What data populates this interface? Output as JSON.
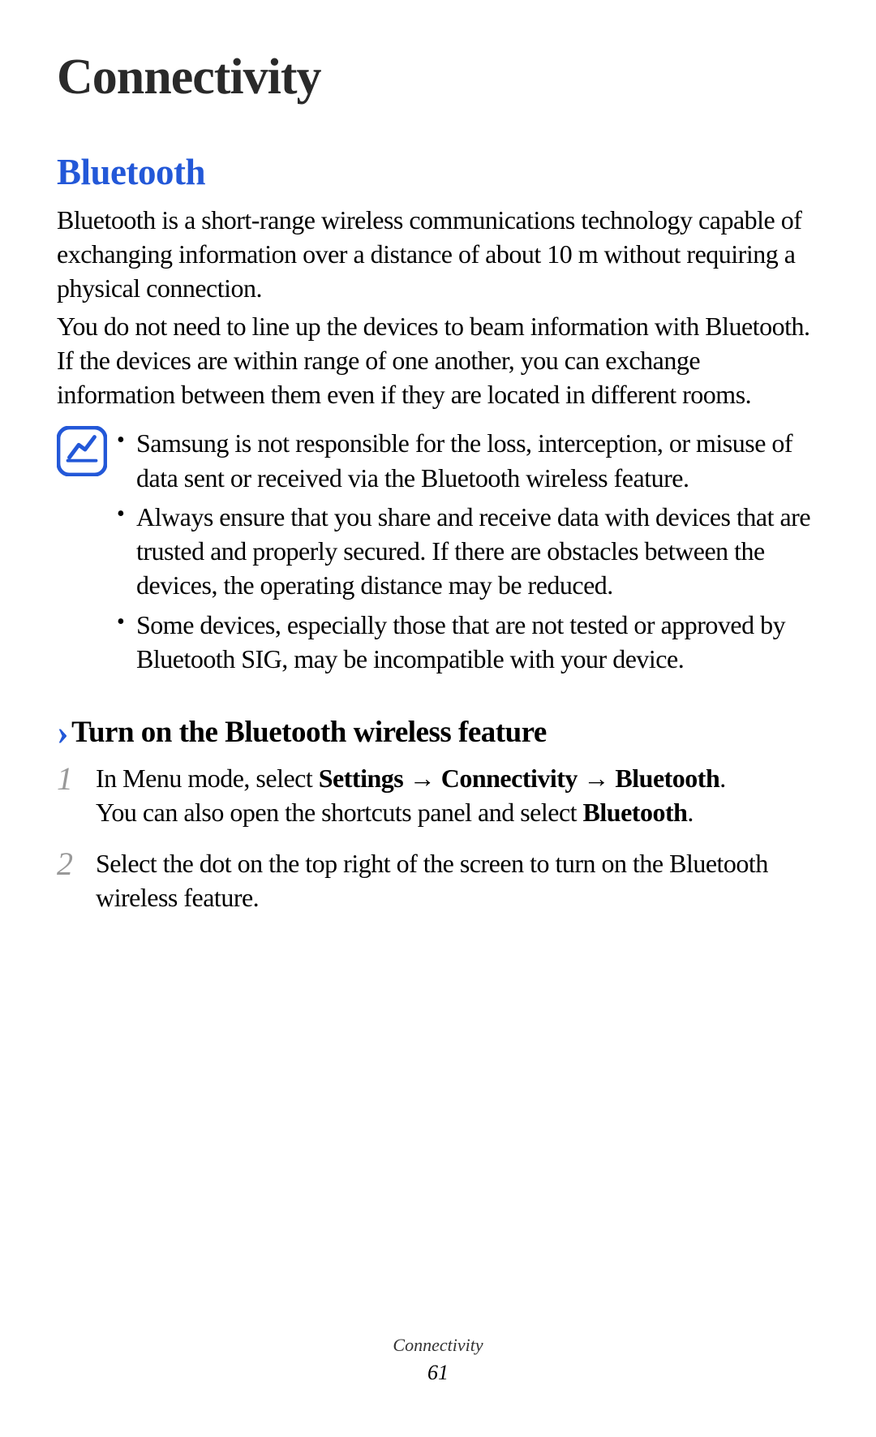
{
  "chapter_title": "Connectivity",
  "section": {
    "title": "Bluetooth",
    "intro_para_1": "Bluetooth is a short-range wireless communications technology capable of exchanging information over a distance of about 10 m without requiring a physical connection.",
    "intro_para_2": "You do not need to line up the devices to beam information with Bluetooth. If the devices are within range of one another, you can exchange information between them even if they are located in different rooms."
  },
  "notes": [
    "Samsung is not responsible for the loss, interception, or misuse of data sent or received via the Bluetooth wireless feature.",
    "Always ensure that you share and receive data with devices that are trusted and properly secured. If there are obstacles between the devices, the operating distance may be reduced.",
    "Some devices, especially those that are not tested or approved by Bluetooth SIG, may be incompatible with your device."
  ],
  "subsection": {
    "title": "Turn on the Bluetooth wireless feature",
    "steps": [
      {
        "number": "1",
        "text_prefix": "In Menu mode, select ",
        "bold_path_1": "Settings",
        "arrow_1": " → ",
        "bold_path_2": "Connectivity",
        "arrow_2": " → ",
        "bold_path_3": "Bluetooth",
        "suffix_1": ".",
        "line_2_prefix": "You can also open the shortcuts panel and select ",
        "line_2_bold": "Bluetooth",
        "line_2_suffix": "."
      },
      {
        "number": "2",
        "text": "Select the dot on the top right of the screen to turn on the Bluetooth wireless feature."
      }
    ]
  },
  "footer": {
    "section_name": "Connectivity",
    "page_number": "61"
  }
}
